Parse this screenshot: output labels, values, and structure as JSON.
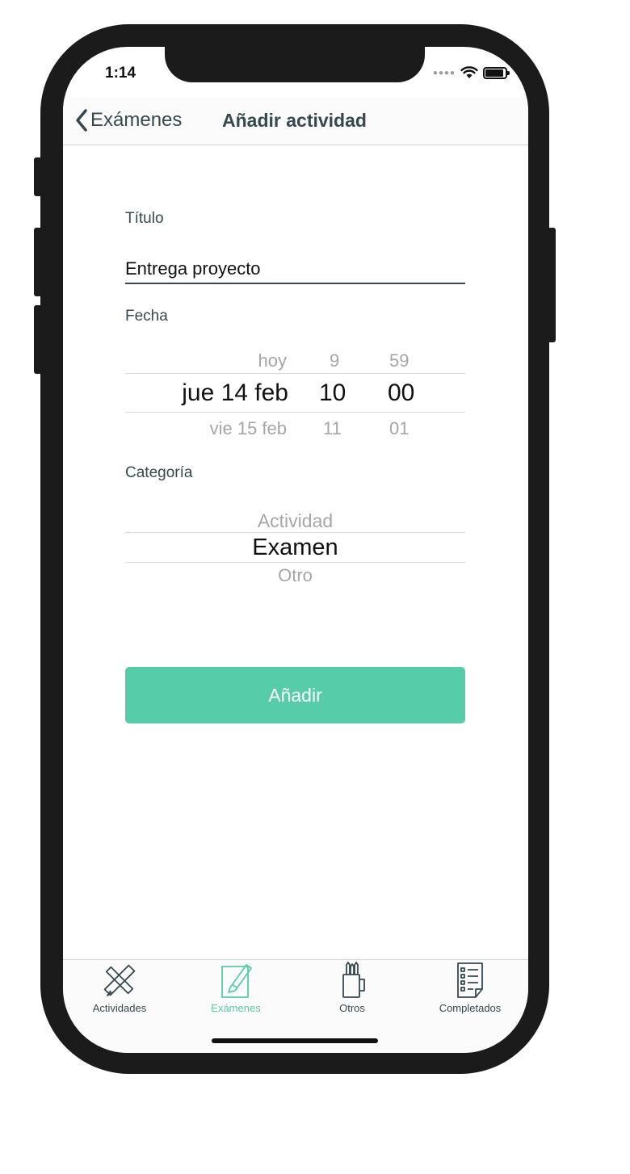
{
  "status": {
    "time": "1:14"
  },
  "nav": {
    "back_label": "Exámenes",
    "title": "Añadir actividad"
  },
  "form": {
    "title_label": "Título",
    "title_value": "Entrega proyecto",
    "date_label": "Fecha",
    "date_picker": {
      "above": {
        "day": "hoy",
        "hour": "9",
        "minute": "59"
      },
      "selected": {
        "day": "jue 14 feb",
        "hour": "10",
        "minute": "00"
      },
      "below": {
        "day": "vie 15 feb",
        "hour": "11",
        "minute": "01"
      }
    },
    "category_label": "Categoría",
    "category_picker": {
      "above": "Actividad",
      "selected": "Examen",
      "below": "Otro"
    },
    "submit_label": "Añadir"
  },
  "tabbar": {
    "tabs": [
      {
        "label": "Actividades",
        "icon": "pencil-ruler-icon",
        "active": false
      },
      {
        "label": "Exámenes",
        "icon": "edit-paper-icon",
        "active": true
      },
      {
        "label": "Otros",
        "icon": "pencil-cup-icon",
        "active": false
      },
      {
        "label": "Completados",
        "icon": "checklist-icon",
        "active": false
      }
    ]
  },
  "colors": {
    "accent": "#56cca8",
    "text_dark": "#35494f",
    "frame": "#1b1b1b"
  }
}
